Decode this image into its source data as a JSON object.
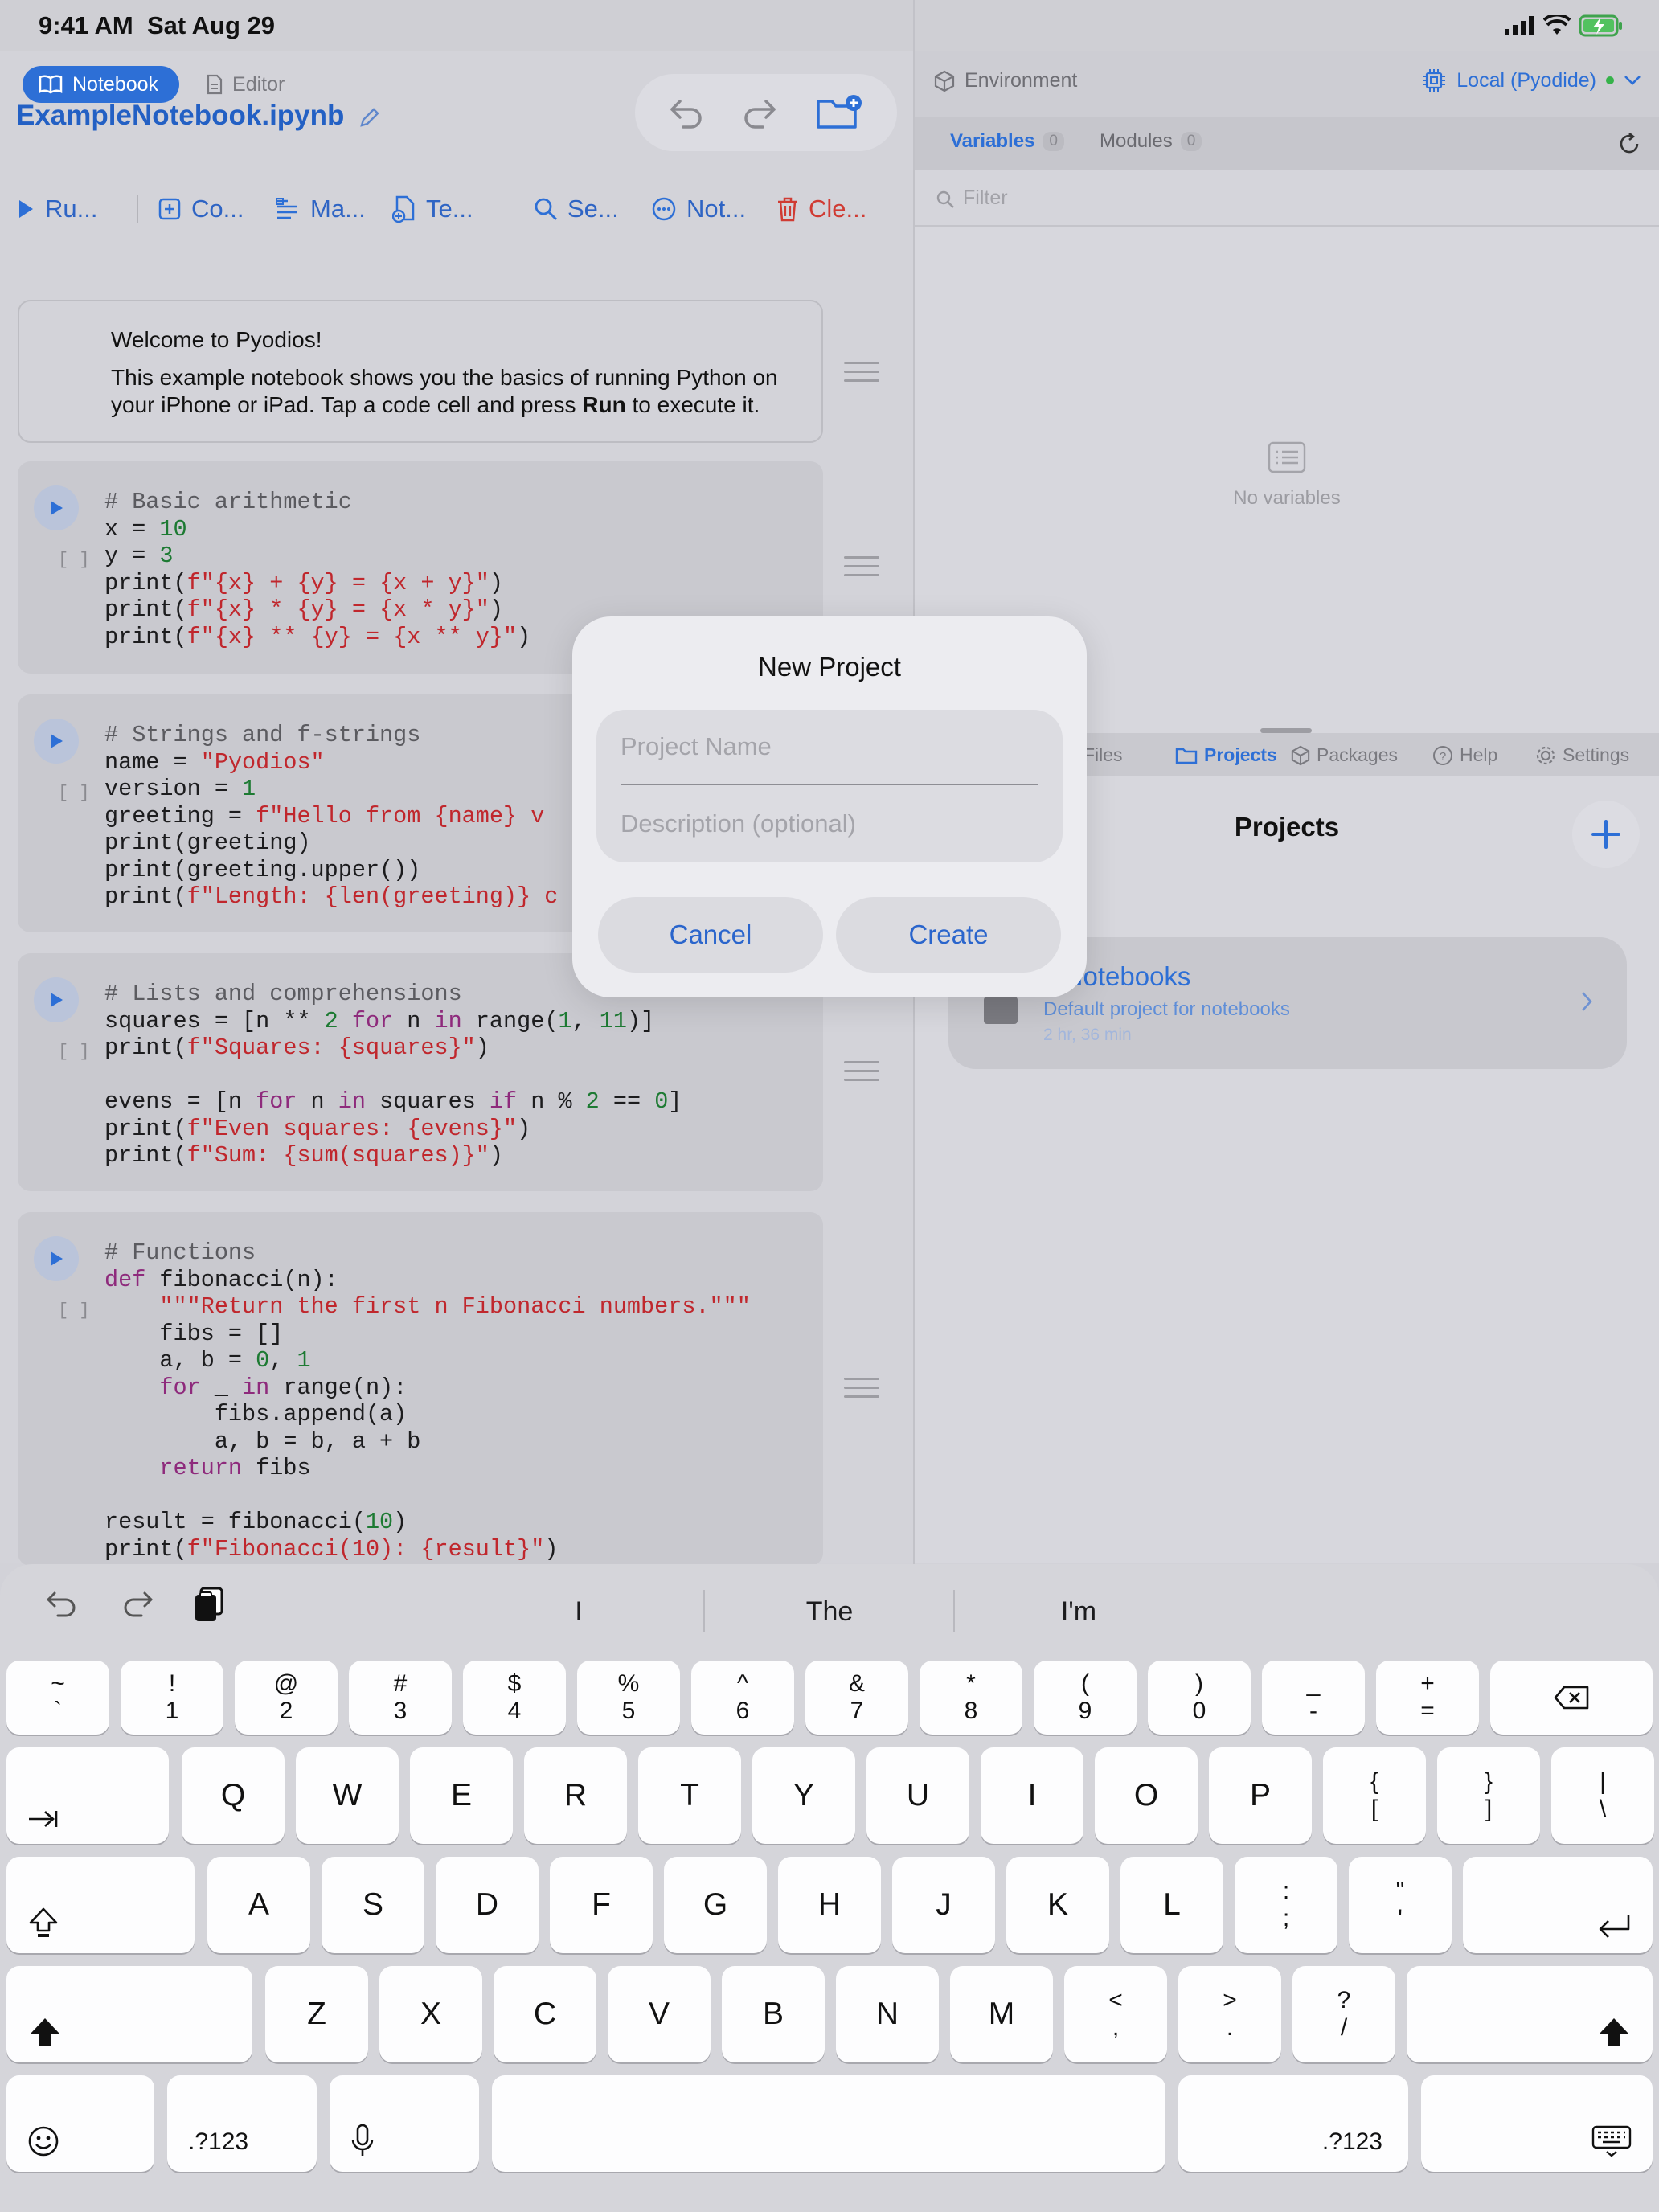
{
  "status_bar": {
    "time": "9:41 AM",
    "date": "Sat Aug 29"
  },
  "mode_switch": {
    "notebook_label": "Notebook",
    "editor_label": "Editor"
  },
  "notebook": {
    "title": "ExampleNotebook.ipynb",
    "toolbar": {
      "run_label": "Ru...",
      "code_label": "Co...",
      "markdown_label": "Ma...",
      "template_label": "Te...",
      "search_label": "Se...",
      "notes_label": "Not...",
      "clear_label": "Cle..."
    },
    "markdown_cell": {
      "heading": "Welcome to Pyodios!",
      "line1": "This example notebook shows you the basics of running Python on",
      "line2_a": "your iPhone or iPad. Tap a code cell and press ",
      "line2_bold": "Run",
      "line2_b": " to execute it."
    },
    "exec_count": "[ ]",
    "cells": [
      {
        "lines": [
          "# Basic arithmetic",
          "x = 10",
          "y = 3",
          "print(f\"{x} + {y} = {x + y}\")",
          "print(f\"{x} * {y} = {x * y}\")",
          "print(f\"{x} ** {y} = {x ** y}\")"
        ]
      },
      {
        "lines": [
          "# Strings and f-strings",
          "name = \"Pyodios\"",
          "version = 1",
          "greeting = f\"Hello from {name} v",
          "print(greeting)",
          "print(greeting.upper())",
          "print(f\"Length: {len(greeting)} c"
        ]
      },
      {
        "lines": [
          "# Lists and comprehensions",
          "squares = [n ** 2 for n in range(1, 11)]",
          "print(f\"Squares: {squares}\")",
          "",
          "evens = [n for n in squares if n % 2 == 0]",
          "print(f\"Even squares: {evens}\")",
          "print(f\"Sum: {sum(squares)}\")"
        ]
      },
      {
        "lines": [
          "# Functions",
          "def fibonacci(n):",
          "    \"\"\"Return the first n Fibonacci numbers.\"\"\"",
          "    fibs = []",
          "    a, b = 0, 1",
          "    for _ in range(n):",
          "        fibs.append(a)",
          "        a, b = b, a + b",
          "    return fibs",
          "",
          "result = fibonacci(10)",
          "print(f\"Fibonacci(10): {result}\")"
        ]
      }
    ]
  },
  "environment": {
    "label": "Environment",
    "runtime": "Local (Pyodide)",
    "tabs": {
      "variables": "Variables",
      "variables_count": "0",
      "modules": "Modules",
      "modules_count": "0"
    },
    "filter_placeholder": "Filter",
    "empty_text": "No variables"
  },
  "bottom_panel": {
    "tabs": {
      "files": "Files",
      "projects": "Projects",
      "packages": "Packages",
      "help": "Help",
      "settings": "Settings"
    },
    "projects_title": "Projects",
    "project": {
      "name_visible": "y Notebooks",
      "description": "Default project for notebooks",
      "time": "2 hr, 36 min"
    }
  },
  "dialog": {
    "title": "New Project",
    "name_placeholder": "Project Name",
    "description_placeholder": "Description (optional)",
    "cancel_label": "Cancel",
    "create_label": "Create"
  },
  "keyboard": {
    "suggestions": [
      "I",
      "The",
      "I'm"
    ],
    "number_row": [
      {
        "top": "~",
        "bottom": "`"
      },
      {
        "top": "!",
        "bottom": "1"
      },
      {
        "top": "@",
        "bottom": "2"
      },
      {
        "top": "#",
        "bottom": "3"
      },
      {
        "top": "$",
        "bottom": "4"
      },
      {
        "top": "%",
        "bottom": "5"
      },
      {
        "top": "^",
        "bottom": "6"
      },
      {
        "top": "&",
        "bottom": "7"
      },
      {
        "top": "*",
        "bottom": "8"
      },
      {
        "top": "(",
        "bottom": "9"
      },
      {
        "top": ")",
        "bottom": "0"
      },
      {
        "top": "_",
        "bottom": "-"
      },
      {
        "top": "+",
        "bottom": "="
      }
    ],
    "row_q": [
      "Q",
      "W",
      "E",
      "R",
      "T",
      "Y",
      "U",
      "I",
      "O",
      "P"
    ],
    "row_q_extra": [
      {
        "top": "{",
        "bottom": "["
      },
      {
        "top": "}",
        "bottom": "]"
      },
      {
        "top": "|",
        "bottom": "\\"
      }
    ],
    "row_a": [
      "A",
      "S",
      "D",
      "F",
      "G",
      "H",
      "J",
      "K",
      "L"
    ],
    "row_a_extra": [
      {
        "top": ":",
        "bottom": ";"
      },
      {
        "top": "\"",
        "bottom": "'"
      }
    ],
    "row_z": [
      "Z",
      "X",
      "C",
      "V",
      "B",
      "N",
      "M"
    ],
    "row_z_extra": [
      {
        "top": "<",
        "bottom": ","
      },
      {
        "top": ">",
        "bottom": "."
      },
      {
        "top": "?",
        "bottom": "/"
      }
    ],
    "numbers_label": ".?123"
  },
  "colors": {
    "accent": "#2d6fd6",
    "destructive": "#d03b33",
    "string": "#c0272d",
    "number": "#1d7a33",
    "comment": "#5b5b60"
  }
}
